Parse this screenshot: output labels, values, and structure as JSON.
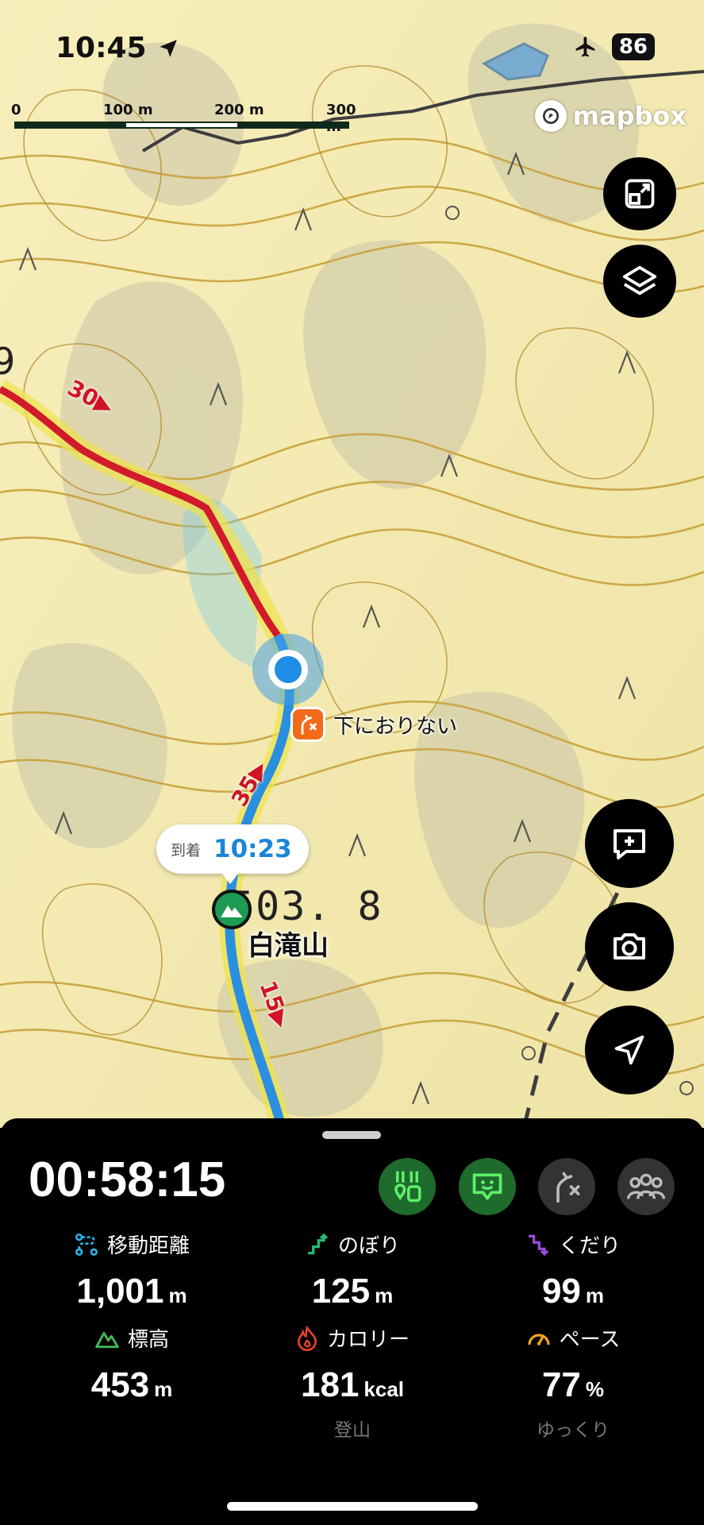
{
  "status_bar": {
    "time": "10:45",
    "battery": "86"
  },
  "map": {
    "scale_labels": [
      "0",
      "100 m",
      "200 m",
      "300 m"
    ],
    "attribution": "mapbox",
    "distance_markers": [
      "30",
      "35",
      "15"
    ],
    "edge_label": "9",
    "poi": {
      "label": "下におりない"
    },
    "arrival": {
      "label": "到着",
      "time": "10:23"
    },
    "summit": {
      "name": "白滝山",
      "elevation": "503. 8"
    }
  },
  "panel": {
    "timer": "00:58:15",
    "stats": [
      {
        "label": "移動距離",
        "value": "1,001",
        "unit": "m",
        "icon": "route-icon",
        "color": "#2ab3e8"
      },
      {
        "label": "のぼり",
        "value": "125",
        "unit": "m",
        "icon": "ascent-icon",
        "color": "#23c17a"
      },
      {
        "label": "くだり",
        "value": "99",
        "unit": "m",
        "icon": "descent-icon",
        "color": "#9b4de0"
      },
      {
        "label": "標高",
        "value": "453",
        "unit": "m",
        "icon": "mountain-icon",
        "color": "#3fba5a"
      },
      {
        "label": "カロリー",
        "value": "181",
        "unit": "kcal",
        "sub": "登山",
        "icon": "flame-icon",
        "color": "#e8412b"
      },
      {
        "label": "ペース",
        "value": "77",
        "unit": "%",
        "sub": "ゆっくり",
        "icon": "speedometer-icon",
        "color": "#f0a41f"
      }
    ]
  }
}
